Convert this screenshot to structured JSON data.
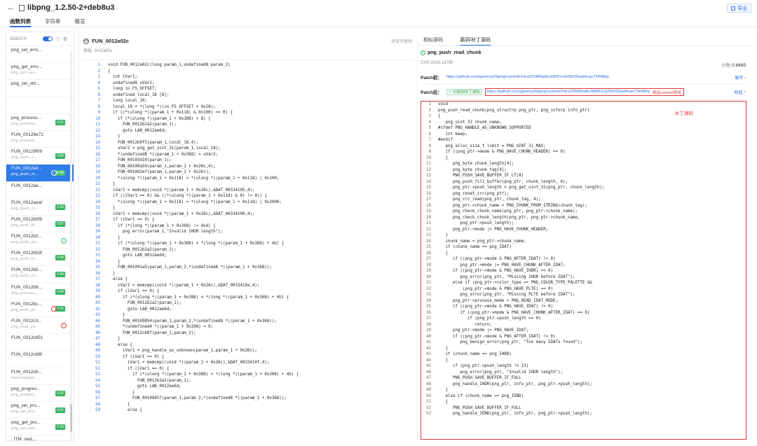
{
  "header": {
    "back": "←",
    "title": "libpng_1.2.50-2+deb8u3",
    "export_label": "导出"
  },
  "tabs": [
    "函数列表",
    "字符串",
    "概览"
  ],
  "left": {
    "count": "358/374",
    "functions": [
      {
        "name": "png_set_erro...",
        "sub": ""
      },
      {
        "name": "png_get_erro...",
        "sub": "png_get_use..."
      },
      {
        "name": "png_set_stri...",
        "sub": ""
      },
      {
        "name": "",
        "sub": ""
      },
      {
        "name": "png_process...",
        "sub": "png_process...",
        "badge": "0.91"
      },
      {
        "name": "FUN_00129e71",
        "sub": "png_process..."
      },
      {
        "name": "FUN_00129f09",
        "sub": "png_push_s...",
        "badge": "0.85"
      },
      {
        "name": "FUN_0012a0...",
        "sub": "png_push_re...",
        "badge": "0.85",
        "mark": "green"
      },
      {
        "name": "FUN_0012ae...",
        "sub": ""
      },
      {
        "name": "FUN_0012aeaf",
        "sub": "png_push_cr...",
        "badge": "0.83"
      },
      {
        "name": "FUN_0012b0f5",
        "sub": "png_push_fil...",
        "badge": "0.87"
      },
      {
        "name": "FUN_0012b2...",
        "sub": "png_push_sa...",
        "marksolo": "green"
      },
      {
        "name": "FUN_0012b53f",
        "sub": "png_push_re...",
        "badge": "0.85"
      },
      {
        "name": "FUN_0012b5...",
        "sub": "png_push_re...",
        "badge": "0.84"
      },
      {
        "name": "FUN_0012b9...",
        "sub": "png_process...",
        "badge": "0.88"
      },
      {
        "name": "FUN_0012bc...",
        "sub": "png_push_pr...",
        "badge": "0.91",
        "mark": "red"
      },
      {
        "name": "FUN_0012c3...",
        "sub": "png_read_pu...",
        "marksolo": "red"
      },
      {
        "name": "FUN_0012c651",
        "sub": ""
      },
      {
        "name": "FUN_0012c68f",
        "sub": ""
      },
      {
        "name": "FUN_0012c6...",
        "sub": "finsComplete..."
      },
      {
        "name": "png_progres...",
        "sub": "png_progres...",
        "badge": "0.92"
      },
      {
        "name": "png_set_pro...",
        "sub": "png_set_pro...",
        "badge": "0.91"
      },
      {
        "name": "png_get_pro...",
        "sub": "png_get_use...",
        "badge": "0.93"
      },
      {
        "name": "_ITM_regi...",
        "sub": "..."
      }
    ]
  },
  "middle": {
    "function_name": "FUN_0012a02c",
    "address": "地址: 0x12a02c",
    "shortcut": "键盘快捷键",
    "code": [
      "void FUN_0012a02c(long param_1,undefined8 param_2)",
      "{",
      "  int iVar1;",
      "  undefined8 uVar2;",
      "  long in_FS_OFFSET;",
      "  undefined local_18 [8];",
      "  long local_10;",
      "  local_10 = *(long *)(in_FS_OFFSET + 0x28);",
      "  if ((*(ulong *)(param_1 + 0x118) & 0x100) == 0) {",
      "    if (*(ulong *)(param_1 + 0x388) < 8) {",
      "      FUN_0012b2a2(param_1);",
      "      goto LAB_0012ae6d;",
      "    }",
      "    FUN_0012b0f5(param_1,local_18,4);",
      "    uVar2 = png_get_uint_31(param_1,local_18);",
      "    *(undefined8 *)(param_1 + 0x368) = uVar2;",
      "    FUN_00103d10(param_1);",
      "    FUN_00100a59(param_1,param_1 + 0x26c,4);",
      "    FUN_0010d2ef(param_1,param_1 + 0x26c);",
      "    *(ulong *)(param_1 + 0x118) = *(ulong *)(param_1 + 0x118) | 0x100;",
      "  }",
      "  iVar1 = memcmp((void *)(param_1 + 0x26c),&DAT_00334105,4);",
      "  if ((iVar1 == 0) && ((*(ulong *)(param_1 + 0x118) & 8) != 0)) {",
      "    *(ulong *)(param_1 + 0x118) = *(ulong *)(param_1 + 0x118) | 0x2000;",
      "  }",
      "  iVar1 = memcmp((void *)(param_1 + 0x26c),&DAT_00334100,4);",
      "  if (iVar1 == 0) {",
      "    if (*(long *)(param_1 + 0x368) != 0xd) {",
      "      png_error(param_1,\"Invalid IHDR length\");",
      "    }",
      "    if (*(ulong *)(param_1 + 0x388) < *(long *)(param_1 + 0x368) + 4U) {",
      "      FUN_0012b2a2(param_1);",
      "      goto LAB_0012ae6d;",
      "    }",
      "    FUN_001091a5(param_1,param_2,*(undefined8 *)(param_1 + 0x368));",
      "  }",
      "  else {",
      "    iVar1 = memcmp((void *)(param_1 + 0x26c),&DAT_0033410a,4);",
      "    if (iVar1 == 0) {",
      "      if (*(ulong *)(param_1 + 0x388) < *(long *)(param_1 + 0x368) + 4U) {",
      "        FUN_0012b2a2(param_1);",
      "        goto LAB_0012ae6d;",
      "      }",
      "      FUN_00109854(param_1,param_2,*(undefined8 *)(param_1 + 0x368));",
      "      *(undefined4 *)(param_1 + 0x398) = 0;",
      "      FUN_0012c68f(param_1,param_2);",
      "    }",
      "    else {",
      "      iVar1 = png_handle_as_unknown(param_1,param_1 + 0x26c);",
      "      if (iVar1 == 0) {",
      "        iVar1 = memcmp((void *)(param_1 + 0x26c),&DAT_0033410f,4);",
      "        if (iVar1 == 0) {",
      "          if (*(ulong *)(param_1 + 0x388) < *(long *)(param_1 + 0x368) + 4U) {",
      "            FUN_0012b2a2(param_1);",
      "            goto LAB_0012ae6d;",
      "          }",
      "          FUN_00109457(param_1,param_2,*(undefined8 *)(param_1 + 0x368));",
      "        }",
      "        else {"
    ]
  },
  "right": {
    "tabs": [
      "相似源码",
      "漏洞/补丁源码"
    ],
    "function_name": "png_push_read_chunk",
    "cve": "CVE-2018-13785",
    "score_label": "分数",
    "score": "0.8465",
    "patch_label_1": "Patch前：",
    "patch_url_1": "https://github.com/glennrp/libpng/commit/2dca15686fadb1b8951cb29b02bad4cae73448da",
    "patch_action_1": "展开 ›",
    "patch_label_2": "Patch后：",
    "patch_pill": "识别到补丁源码",
    "patch_url_2": "https://github.com/glennrp/libpng/commit/2dca15686fadb1b8951cb29b02bad4cae73448da",
    "patch_note": "相关commit地址",
    "patch_action_2": "收起 ^",
    "code_title": "补丁源码",
    "code": [
      "void",
      "png_push_read_chunk(png_structrp png_ptr, png_inforp info_ptr)",
      "{",
      "   png_uint_32 chunk_name;",
      "#ifdef PNG_HANDLE_AS_UNKNOWN_SUPPORTED",
      "   int keep;",
      "#endif",
      "   png_alloc_size_t limit = PNG_UINT_31_MAX;",
      "   if ((png_ptr->mode & PNG_HAVE_CHUNK_HEADER) == 0)",
      "   {",
      "      png_byte chunk_length[4];",
      "      png_byte chunk_tag[4];",
      "      PNG_PUSH_SAVE_BUFFER_IF_LT(8)",
      "      png_push_fill_buffer(png_ptr, chunk_length, 4);",
      "      png_ptr->push_length = png_get_uint_31(png_ptr, chunk_length);",
      "      png_reset_crc(png_ptr);",
      "      png_crc_read(png_ptr, chunk_tag, 4);",
      "      png_ptr->chunk_name = PNG_CHUNK_FROM_STRING(chunk_tag);",
      "      png_check_chunk_name(png_ptr, png_ptr->chunk_name);",
      "      png_check_chunk_length(png_ptr, png_ptr->chunk_name,",
      "         png_ptr->push_length);",
      "      png_ptr->mode |= PNG_HAVE_CHUNK_HEADER;",
      "   }",
      "   chunk_name = png_ptr->chunk_name;",
      "   if (chunk_name == png_IDAT)",
      "   {",
      "      if ((png_ptr->mode & PNG_AFTER_IDAT) != 0)",
      "         png_ptr->mode |= PNG_HAVE_CHUNK_AFTER_IDAT;",
      "      if ((png_ptr->mode & PNG_HAVE_IHDR) == 0)",
      "         png_error(png_ptr, \"Missing IHDR before IDAT\");",
      "      else if (png_ptr->color_type == PNG_COLOR_TYPE_PALETTE &&",
      "          (png_ptr->mode & PNG_HAVE_PLTE) == 0)",
      "         png_error(png_ptr, \"Missing PLTE before IDAT\");",
      "      png_ptr->process_mode = PNG_READ_IDAT_MODE;",
      "      if ((png_ptr->mode & PNG_HAVE_IDAT) != 0)",
      "         if ((png_ptr->mode & PNG_HAVE_CHUNK_AFTER_IDAT) == 0)",
      "            if (png_ptr->push_length == 0)",
      "               return;",
      "      png_ptr->mode |= PNG_HAVE_IDAT;",
      "      if ((png_ptr->mode & PNG_AFTER_IDAT) != 0)",
      "         png_benign_error(png_ptr, \"Too many IDATs found\");",
      "   }",
      "   if (chunk_name == png_IHDR)",
      "   {",
      "      if (png_ptr->push_length != 13)",
      "         png_error(png_ptr, \"Invalid IHDR length\");",
      "      PNG_PUSH_SAVE_BUFFER_IF_FULL",
      "      png_handle_IHDR(png_ptr, info_ptr, png_ptr->push_length);",
      "   }",
      "   else if (chunk_name == png_IEND)",
      "   {",
      "      PNG_PUSH_SAVE_BUFFER_IF_FULL",
      "      png_handle_IEND(png_ptr, info_ptr, png_ptr->push_length);"
    ]
  }
}
